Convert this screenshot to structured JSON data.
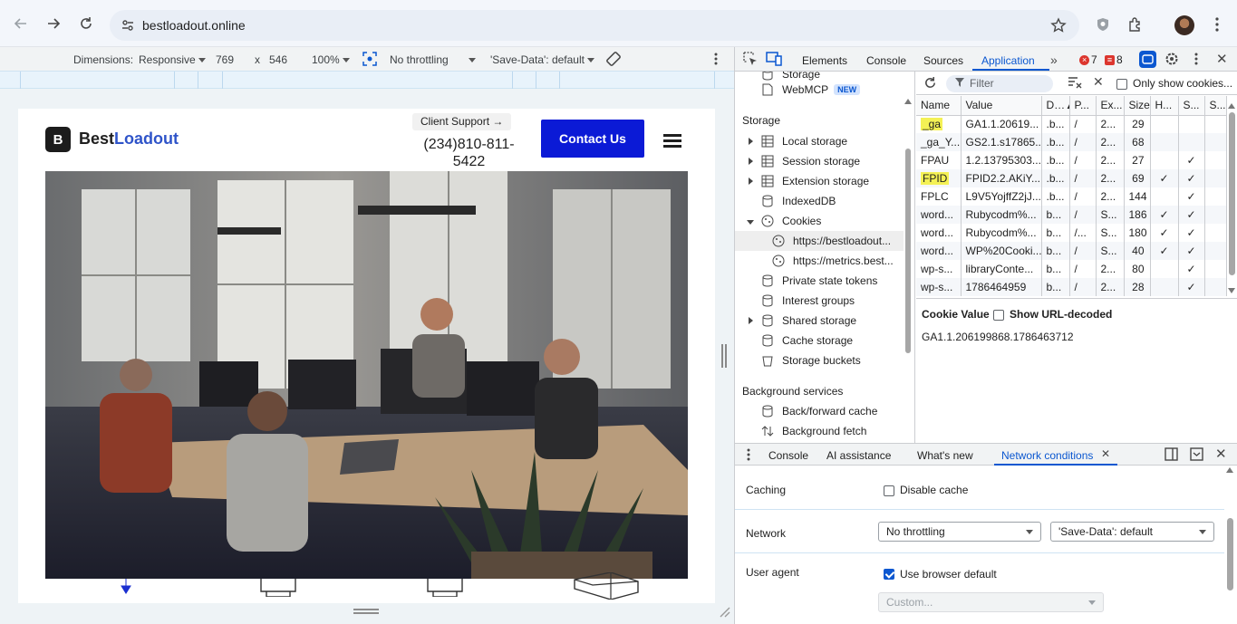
{
  "browser": {
    "url": "bestloadout.online"
  },
  "device_toolbar": {
    "dimensions_label": "Dimensions:",
    "mode": "Responsive",
    "width": "769",
    "times": "x",
    "height": "546",
    "zoom": "100%",
    "throttling": "No throttling",
    "save_data": "'Save-Data': default"
  },
  "site": {
    "logo_letter": "B",
    "brand_part1": "Best",
    "brand_part2": "Loadout",
    "support_label": "Client Support →",
    "phone": "(234)810-811-5422",
    "contact_button": "Contact Us"
  },
  "devtools": {
    "tabs": [
      "Elements",
      "Console",
      "Sources",
      "Application"
    ],
    "errors": "7",
    "warnings": "8",
    "tree": {
      "storage_top_partial": "Storage",
      "webmcp": "WebMCP",
      "new_badge": "NEW",
      "storage_section": "Storage",
      "local_storage": "Local storage",
      "session_storage": "Session storage",
      "extension_storage": "Extension storage",
      "indexeddb": "IndexedDB",
      "cookies": "Cookies",
      "cookie_site1": "https://bestloadout...",
      "cookie_site2": "https://metrics.best...",
      "private_state_tokens": "Private state tokens",
      "interest_groups": "Interest groups",
      "shared_storage": "Shared storage",
      "cache_storage": "Cache storage",
      "storage_buckets": "Storage buckets",
      "background_section": "Background services",
      "bfcache": "Back/forward cache",
      "background_fetch": "Background fetch"
    },
    "cookies": {
      "filter_placeholder": "Filter",
      "only_show_label": "Only show cookies...",
      "headers": [
        "Name",
        "Value",
        "D…▲",
        "P...",
        "Ex...",
        "Size",
        "H...",
        "S...",
        "S..."
      ],
      "rows": [
        {
          "name": "_ga",
          "value": "GA1.1.20619...",
          "domain": ".b...",
          "path": "/",
          "expires": "2...",
          "size": "29",
          "http": "",
          "secure": "",
          "same": "",
          "highlight": true
        },
        {
          "name": "_ga_Y...",
          "value": "GS2.1.s17865...",
          "domain": ".b...",
          "path": "/",
          "expires": "2...",
          "size": "68",
          "http": "",
          "secure": "",
          "same": "",
          "highlight": false
        },
        {
          "name": "FPAU",
          "value": "1.2.13795303...",
          "domain": ".b...",
          "path": "/",
          "expires": "2...",
          "size": "27",
          "http": "",
          "secure": "✓",
          "same": "",
          "highlight": false
        },
        {
          "name": "FPID",
          "value": "FPID2.2.AKiY...",
          "domain": ".b...",
          "path": "/",
          "expires": "2...",
          "size": "69",
          "http": "✓",
          "secure": "✓",
          "same": "",
          "highlight": true
        },
        {
          "name": "FPLC",
          "value": "L9V5YojffZ2jJ...",
          "domain": ".b...",
          "path": "/",
          "expires": "2...",
          "size": "144",
          "http": "",
          "secure": "✓",
          "same": "",
          "highlight": false
        },
        {
          "name": "word...",
          "value": "Rubycodm%...",
          "domain": "b...",
          "path": "/",
          "expires": "S...",
          "size": "186",
          "http": "✓",
          "secure": "✓",
          "same": "",
          "highlight": false
        },
        {
          "name": "word...",
          "value": "Rubycodm%...",
          "domain": "b...",
          "path": "/...",
          "expires": "S...",
          "size": "180",
          "http": "✓",
          "secure": "✓",
          "same": "",
          "highlight": false
        },
        {
          "name": "word...",
          "value": "WP%20Cooki...",
          "domain": "b...",
          "path": "/",
          "expires": "S...",
          "size": "40",
          "http": "✓",
          "secure": "✓",
          "same": "",
          "highlight": false
        },
        {
          "name": "wp-s...",
          "value": "libraryConte...",
          "domain": "b...",
          "path": "/",
          "expires": "2...",
          "size": "80",
          "http": "",
          "secure": "✓",
          "same": "",
          "highlight": false
        },
        {
          "name": "wp-s...",
          "value": "1786464959",
          "domain": "b...",
          "path": "/",
          "expires": "2...",
          "size": "28",
          "http": "",
          "secure": "✓",
          "same": "",
          "highlight": false
        }
      ],
      "cookie_value_label": "Cookie Value",
      "show_decoded_label": "Show URL-decoded",
      "cookie_value": "GA1.1.206199868.1786463712"
    },
    "drawer": {
      "tabs": [
        "Console",
        "AI assistance",
        "What's new",
        "Network conditions"
      ],
      "caching_label": "Caching",
      "disable_cache_label": "Disable cache",
      "network_label": "Network",
      "network_throttling": "No throttling",
      "network_save_data": "'Save-Data': default",
      "user_agent_label": "User agent",
      "use_browser_default": "Use browser default",
      "custom_placeholder": "Custom..."
    }
  }
}
